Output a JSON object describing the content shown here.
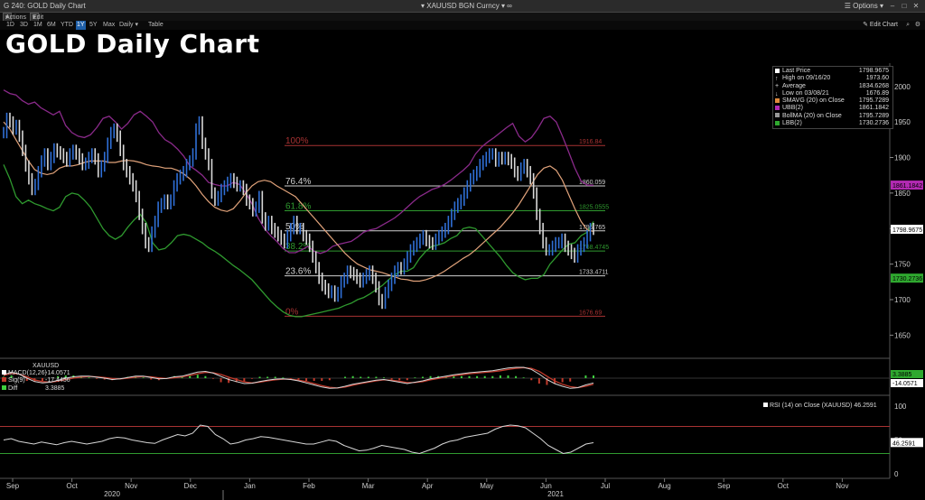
{
  "window": {
    "title": "G 240: GOLD Daily Chart",
    "ticker": "XAUUSD BGN Curncy",
    "options_label": "Options"
  },
  "toolbar": {
    "actions_label": "Actions",
    "edit_label": "Edit"
  },
  "ranges": {
    "items": [
      "1D",
      "3D",
      "1M",
      "6M",
      "YTD",
      "1Y",
      "5Y",
      "Max"
    ],
    "active": "1Y",
    "frequency": "Daily",
    "table_label": "Table",
    "edit_chart_label": "Edit Chart"
  },
  "colors": {
    "price_up": "#2f6fd6",
    "price_down": "#d8d8d8",
    "sma": "#e0a27a",
    "ubb": "#8a2a8a",
    "lbb": "#2f9a2f",
    "macd": "#d8d8d8",
    "signal": "#c0392b",
    "diff": "#3fcf3f",
    "rsi": "#d8d8d8",
    "rsi_upper": "#a83232",
    "rsi_lower": "#2f9a2f",
    "fib_100": "#a83232",
    "fib_mid": "#cfcfcf",
    "fib_618": "#2f9a2f",
    "fib_0": "#a83232"
  },
  "chart_data": {
    "type": "line",
    "title": "GOLD Daily Chart",
    "ylim": [
      1620,
      2020
    ],
    "ytick_labels": [
      "2000",
      "1950",
      "1900",
      "1850",
      "1800",
      "1750",
      "1700",
      "1650"
    ],
    "yticks": [
      2000,
      1950,
      1900,
      1850,
      1800,
      1750,
      1700,
      1650
    ],
    "x_months": [
      "Sep",
      "Oct",
      "Nov",
      "Dec",
      "Jan",
      "Feb",
      "Mar",
      "Apr",
      "May",
      "Jun",
      "Jul",
      "Aug",
      "Sep",
      "Oct",
      "Nov"
    ],
    "x_years": [
      "2020",
      "2021"
    ],
    "legend": {
      "last_price": {
        "label": "Last Price",
        "value": "1798.9675"
      },
      "high": {
        "label": "High on 09/16/20",
        "value": "1973.60"
      },
      "average": {
        "label": "Average",
        "value": "1834.6268"
      },
      "low": {
        "label": "Low on 03/08/21",
        "value": "1676.89"
      },
      "smavg": {
        "label": "SMAVG (20)  on Close",
        "value": "1795.7289"
      },
      "ubb": {
        "label": "UBB(2)",
        "value": "1861.1842"
      },
      "bollma": {
        "label": "BollMA (20)  on Close",
        "value": "1795.7289"
      },
      "lbb": {
        "label": "LBB(2)",
        "value": "1730.2736"
      }
    },
    "fib_levels": [
      {
        "label": "100%",
        "value": 1916.84,
        "text": "1916.84"
      },
      {
        "label": "76.4%",
        "value": 1860.059,
        "text": "1860.059"
      },
      {
        "label": "61.8%",
        "value": 1825.0555,
        "text": "1825.0555"
      },
      {
        "label": "50%",
        "value": 1796.765,
        "text": "1796.765"
      },
      {
        "label": "38.2%",
        "value": 1768.4745,
        "text": "1768.4745"
      },
      {
        "label": "23.6%",
        "value": 1733.4711,
        "text": "1733.4711"
      },
      {
        "label": "0%",
        "value": 1676.69,
        "text": "1676.69"
      }
    ],
    "axis_tags": [
      {
        "text": "1861.1842",
        "value": 1861.18,
        "color": "#b22ab2"
      },
      {
        "text": "1798.9675",
        "value": 1799,
        "color": "#ffffff"
      },
      {
        "text": "1730.2736",
        "value": 1730.27,
        "color": "#2fa82f"
      }
    ],
    "series": [
      {
        "name": "Last Price",
        "values": [
          1935,
          1955,
          1950,
          1940,
          1945,
          1930,
          1910,
          1888,
          1870,
          1855,
          1862,
          1880,
          1895,
          1905,
          1890,
          1900,
          1912,
          1908,
          1905,
          1900,
          1895,
          1905,
          1910,
          1905,
          1898,
          1890,
          1892,
          1900,
          1905,
          1898,
          1880,
          1888,
          1900,
          1920,
          1935,
          1940,
          1930,
          1910,
          1890,
          1880,
          1870,
          1860,
          1845,
          1820,
          1800,
          1780,
          1775,
          1795,
          1810,
          1830,
          1835,
          1840,
          1835,
          1840,
          1860,
          1870,
          1875,
          1880,
          1890,
          1895,
          1905,
          1940,
          1950,
          1920,
          1905,
          1890,
          1850,
          1840,
          1845,
          1855,
          1860,
          1865,
          1870,
          1865,
          1860,
          1860,
          1855,
          1840,
          1835,
          1825,
          1830,
          1845,
          1815,
          1805,
          1810,
          1800,
          1795,
          1790,
          1785,
          1780,
          1790,
          1800,
          1810,
          1800,
          1800,
          1790,
          1785,
          1775,
          1760,
          1745,
          1730,
          1720,
          1715,
          1710,
          1712,
          1705,
          1710,
          1725,
          1730,
          1740,
          1738,
          1735,
          1730,
          1725,
          1730,
          1735,
          1740,
          1730,
          1718,
          1700,
          1695,
          1710,
          1720,
          1730,
          1740,
          1745,
          1743,
          1750,
          1760,
          1770,
          1775,
          1780,
          1785,
          1790,
          1783,
          1780,
          1778,
          1785,
          1790,
          1795,
          1800,
          1810,
          1820,
          1830,
          1835,
          1840,
          1850,
          1860,
          1870,
          1875,
          1880,
          1890,
          1895,
          1900,
          1905,
          1905,
          1895,
          1900,
          1898,
          1900,
          1897,
          1892,
          1880,
          1875,
          1885,
          1890,
          1880,
          1870,
          1850,
          1820,
          1800,
          1780,
          1770,
          1770,
          1775,
          1780,
          1780,
          1785,
          1775,
          1770,
          1765,
          1760,
          1770,
          1775,
          1780,
          1790,
          1800,
          1799
        ]
      },
      {
        "name": "SMAVG (20)",
        "values": [
          1950,
          1940,
          1925,
          1910,
          1895,
          1883,
          1878,
          1876,
          1878,
          1885,
          1888,
          1888,
          1890,
          1893,
          1895,
          1895,
          1895,
          1893,
          1893,
          1895,
          1896,
          1895,
          1893,
          1890,
          1888,
          1887,
          1885,
          1885,
          1882,
          1877,
          1870,
          1860,
          1848,
          1838,
          1830,
          1826,
          1824,
          1828,
          1838,
          1850,
          1860,
          1866,
          1868,
          1866,
          1860,
          1855,
          1850,
          1845,
          1835,
          1825,
          1815,
          1805,
          1795,
          1785,
          1775,
          1765,
          1757,
          1750,
          1746,
          1742,
          1740,
          1738,
          1735,
          1732,
          1729,
          1728,
          1726,
          1726,
          1728,
          1731,
          1735,
          1740,
          1746,
          1752,
          1758,
          1763,
          1770,
          1778,
          1786,
          1794,
          1802,
          1812,
          1822,
          1834,
          1848,
          1862,
          1876,
          1885,
          1888,
          1882,
          1868,
          1848,
          1828,
          1810,
          1798,
          1796
        ]
      },
      {
        "name": "UBB(2)",
        "values": [
          1995,
          1990,
          1988,
          1980,
          1975,
          1978,
          1970,
          1965,
          1960,
          1965,
          1945,
          1935,
          1930,
          1928,
          1932,
          1942,
          1955,
          1958,
          1950,
          1940,
          1948,
          1960,
          1965,
          1958,
          1950,
          1935,
          1925,
          1920,
          1912,
          1902,
          1888,
          1882,
          1875,
          1865,
          1862,
          1860,
          1860,
          1865,
          1862,
          1850,
          1835,
          1815,
          1800,
          1790,
          1782,
          1772,
          1766,
          1766,
          1770,
          1775,
          1768,
          1765,
          1768,
          1775,
          1778,
          1780,
          1782,
          1788,
          1795,
          1798,
          1800,
          1805,
          1810,
          1815,
          1822,
          1830,
          1838,
          1845,
          1850,
          1855,
          1858,
          1862,
          1868,
          1875,
          1882,
          1890,
          1905,
          1915,
          1922,
          1928,
          1935,
          1942,
          1948,
          1930,
          1922,
          1928,
          1940,
          1955,
          1958,
          1950,
          1930,
          1908,
          1885,
          1867,
          1861,
          1861
        ]
      },
      {
        "name": "LBB(2)",
        "values": [
          1890,
          1870,
          1845,
          1835,
          1840,
          1835,
          1832,
          1828,
          1825,
          1830,
          1845,
          1850,
          1848,
          1840,
          1830,
          1815,
          1800,
          1790,
          1785,
          1790,
          1802,
          1812,
          1820,
          1808,
          1780,
          1770,
          1772,
          1780,
          1790,
          1792,
          1790,
          1785,
          1780,
          1773,
          1768,
          1762,
          1755,
          1748,
          1742,
          1735,
          1728,
          1718,
          1708,
          1698,
          1690,
          1683,
          1678,
          1676,
          1676,
          1678,
          1680,
          1682,
          1684,
          1686,
          1688,
          1692,
          1695,
          1700,
          1703,
          1708,
          1714,
          1720,
          1728,
          1735,
          1740,
          1740,
          1745,
          1758,
          1768,
          1775,
          1777,
          1780,
          1786,
          1790,
          1800,
          1802,
          1800,
          1790,
          1780,
          1770,
          1760,
          1748,
          1738,
          1732,
          1728,
          1730,
          1730,
          1735,
          1750,
          1760,
          1770,
          1778,
          1780,
          1790,
          1795,
          1810
        ]
      }
    ],
    "macd": {
      "label": "XAUUSD",
      "rows": [
        {
          "name": "MACD(12,26)",
          "value": "-14.0571",
          "color": "#ffffff"
        },
        {
          "name": "Sig(9)",
          "value": "-17.4456",
          "color": "#c0392b"
        },
        {
          "name": "Diff",
          "value": "3.3885",
          "color": "#3fcf3f"
        }
      ],
      "axis_tags": [
        {
          "text": "3.3885",
          "color": "#2fa82f"
        },
        {
          "text": "-14.0571",
          "color": "#ffffff"
        }
      ],
      "values": [
        10,
        18,
        12,
        0,
        -10,
        -14,
        -12,
        -6,
        0,
        4,
        6,
        6,
        3,
        0,
        -4,
        -2,
        2,
        6,
        6,
        2,
        -2,
        -1,
        4,
        6,
        12,
        18,
        20,
        15,
        5,
        -4,
        -10,
        -16,
        -15,
        -10,
        -6,
        -3,
        -2,
        -4,
        -8,
        -14,
        -20,
        -26,
        -30,
        -29,
        -24,
        -18,
        -14,
        -10,
        -6,
        -4,
        -8,
        -12,
        -16,
        -12,
        -8,
        -2,
        2,
        6,
        10,
        13,
        16,
        18,
        20,
        22,
        26,
        30,
        32,
        32,
        26,
        12,
        -4,
        -16,
        -24,
        -30,
        -28,
        -20,
        -14
      ],
      "signal": [
        8,
        14,
        12,
        4,
        -5,
        -10,
        -12,
        -9,
        -4,
        0,
        3,
        5,
        4,
        2,
        -1,
        -2,
        0,
        3,
        5,
        4,
        1,
        -1,
        1,
        4,
        8,
        13,
        17,
        16,
        11,
        3,
        -4,
        -11,
        -14,
        -12,
        -8,
        -5,
        -3,
        -3,
        -6,
        -10,
        -16,
        -22,
        -27,
        -29,
        -26,
        -21,
        -16,
        -12,
        -8,
        -5,
        -6,
        -9,
        -13,
        -13,
        -10,
        -5,
        -1,
        3,
        7,
        10,
        13,
        15,
        17,
        19,
        22,
        26,
        29,
        31,
        29,
        20,
        6,
        -8,
        -18,
        -25,
        -28,
        -24,
        -18
      ]
    },
    "rsi": {
      "label": "RSI (14)  on Close (XAUUSD)",
      "value": "46.2591",
      "ytick_labels": [
        "100",
        "50",
        "0"
      ],
      "yticks": [
        100,
        50,
        0
      ],
      "upper": 70,
      "lower": 30,
      "values": [
        50,
        52,
        48,
        46,
        44,
        47,
        45,
        43,
        46,
        48,
        46,
        44,
        46,
        48,
        52,
        54,
        53,
        50,
        48,
        46,
        45,
        50,
        54,
        58,
        56,
        60,
        72,
        70,
        58,
        52,
        44,
        46,
        50,
        52,
        55,
        54,
        52,
        50,
        48,
        46,
        44,
        44,
        47,
        50,
        48,
        42,
        38,
        34,
        35,
        38,
        42,
        40,
        38,
        36,
        32,
        30,
        34,
        38,
        44,
        48,
        50,
        54,
        56,
        58,
        60,
        66,
        70,
        72,
        71,
        68,
        60,
        52,
        42,
        36,
        30,
        32,
        38,
        44,
        46
      ]
    }
  }
}
